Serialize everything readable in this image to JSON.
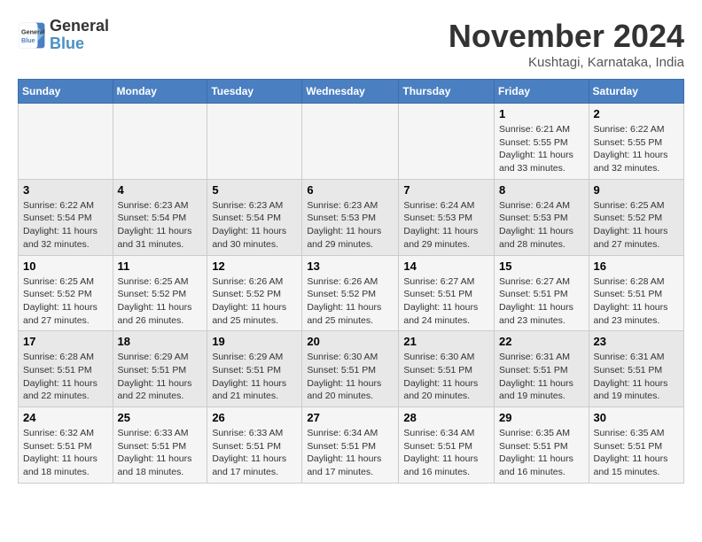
{
  "header": {
    "logo_line1": "General",
    "logo_line2": "Blue",
    "month_title": "November 2024",
    "subtitle": "Kushtagi, Karnataka, India"
  },
  "weekdays": [
    "Sunday",
    "Monday",
    "Tuesday",
    "Wednesday",
    "Thursday",
    "Friday",
    "Saturday"
  ],
  "weeks": [
    [
      {
        "day": "",
        "info": ""
      },
      {
        "day": "",
        "info": ""
      },
      {
        "day": "",
        "info": ""
      },
      {
        "day": "",
        "info": ""
      },
      {
        "day": "",
        "info": ""
      },
      {
        "day": "1",
        "info": "Sunrise: 6:21 AM\nSunset: 5:55 PM\nDaylight: 11 hours and 33 minutes."
      },
      {
        "day": "2",
        "info": "Sunrise: 6:22 AM\nSunset: 5:55 PM\nDaylight: 11 hours and 32 minutes."
      }
    ],
    [
      {
        "day": "3",
        "info": "Sunrise: 6:22 AM\nSunset: 5:54 PM\nDaylight: 11 hours and 32 minutes."
      },
      {
        "day": "4",
        "info": "Sunrise: 6:23 AM\nSunset: 5:54 PM\nDaylight: 11 hours and 31 minutes."
      },
      {
        "day": "5",
        "info": "Sunrise: 6:23 AM\nSunset: 5:54 PM\nDaylight: 11 hours and 30 minutes."
      },
      {
        "day": "6",
        "info": "Sunrise: 6:23 AM\nSunset: 5:53 PM\nDaylight: 11 hours and 29 minutes."
      },
      {
        "day": "7",
        "info": "Sunrise: 6:24 AM\nSunset: 5:53 PM\nDaylight: 11 hours and 29 minutes."
      },
      {
        "day": "8",
        "info": "Sunrise: 6:24 AM\nSunset: 5:53 PM\nDaylight: 11 hours and 28 minutes."
      },
      {
        "day": "9",
        "info": "Sunrise: 6:25 AM\nSunset: 5:52 PM\nDaylight: 11 hours and 27 minutes."
      }
    ],
    [
      {
        "day": "10",
        "info": "Sunrise: 6:25 AM\nSunset: 5:52 PM\nDaylight: 11 hours and 27 minutes."
      },
      {
        "day": "11",
        "info": "Sunrise: 6:25 AM\nSunset: 5:52 PM\nDaylight: 11 hours and 26 minutes."
      },
      {
        "day": "12",
        "info": "Sunrise: 6:26 AM\nSunset: 5:52 PM\nDaylight: 11 hours and 25 minutes."
      },
      {
        "day": "13",
        "info": "Sunrise: 6:26 AM\nSunset: 5:52 PM\nDaylight: 11 hours and 25 minutes."
      },
      {
        "day": "14",
        "info": "Sunrise: 6:27 AM\nSunset: 5:51 PM\nDaylight: 11 hours and 24 minutes."
      },
      {
        "day": "15",
        "info": "Sunrise: 6:27 AM\nSunset: 5:51 PM\nDaylight: 11 hours and 23 minutes."
      },
      {
        "day": "16",
        "info": "Sunrise: 6:28 AM\nSunset: 5:51 PM\nDaylight: 11 hours and 23 minutes."
      }
    ],
    [
      {
        "day": "17",
        "info": "Sunrise: 6:28 AM\nSunset: 5:51 PM\nDaylight: 11 hours and 22 minutes."
      },
      {
        "day": "18",
        "info": "Sunrise: 6:29 AM\nSunset: 5:51 PM\nDaylight: 11 hours and 22 minutes."
      },
      {
        "day": "19",
        "info": "Sunrise: 6:29 AM\nSunset: 5:51 PM\nDaylight: 11 hours and 21 minutes."
      },
      {
        "day": "20",
        "info": "Sunrise: 6:30 AM\nSunset: 5:51 PM\nDaylight: 11 hours and 20 minutes."
      },
      {
        "day": "21",
        "info": "Sunrise: 6:30 AM\nSunset: 5:51 PM\nDaylight: 11 hours and 20 minutes."
      },
      {
        "day": "22",
        "info": "Sunrise: 6:31 AM\nSunset: 5:51 PM\nDaylight: 11 hours and 19 minutes."
      },
      {
        "day": "23",
        "info": "Sunrise: 6:31 AM\nSunset: 5:51 PM\nDaylight: 11 hours and 19 minutes."
      }
    ],
    [
      {
        "day": "24",
        "info": "Sunrise: 6:32 AM\nSunset: 5:51 PM\nDaylight: 11 hours and 18 minutes."
      },
      {
        "day": "25",
        "info": "Sunrise: 6:33 AM\nSunset: 5:51 PM\nDaylight: 11 hours and 18 minutes."
      },
      {
        "day": "26",
        "info": "Sunrise: 6:33 AM\nSunset: 5:51 PM\nDaylight: 11 hours and 17 minutes."
      },
      {
        "day": "27",
        "info": "Sunrise: 6:34 AM\nSunset: 5:51 PM\nDaylight: 11 hours and 17 minutes."
      },
      {
        "day": "28",
        "info": "Sunrise: 6:34 AM\nSunset: 5:51 PM\nDaylight: 11 hours and 16 minutes."
      },
      {
        "day": "29",
        "info": "Sunrise: 6:35 AM\nSunset: 5:51 PM\nDaylight: 11 hours and 16 minutes."
      },
      {
        "day": "30",
        "info": "Sunrise: 6:35 AM\nSunset: 5:51 PM\nDaylight: 11 hours and 15 minutes."
      }
    ]
  ]
}
